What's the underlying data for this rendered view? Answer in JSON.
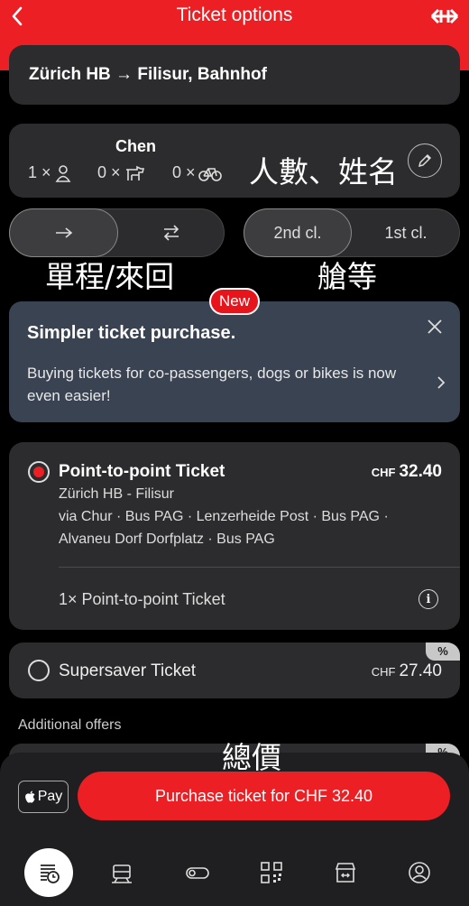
{
  "header": {
    "title": "Ticket options"
  },
  "route": {
    "text": "Zürich HB → Filisur, Bahnhof"
  },
  "travellers": {
    "name": "Chen",
    "adults": "1 ×",
    "dogs": "0 ×",
    "bikes": "0 ×"
  },
  "annotations": {
    "people": "人數、姓名",
    "trip_type": "單程/來回",
    "class": "艙等",
    "total": "總價"
  },
  "trip_toggle": {
    "one_way_icon": "arrow-right-icon",
    "return_icon": "arrows-swap-icon",
    "selected": "one-way"
  },
  "class_toggle": {
    "second": "2nd cl.",
    "first": "1st cl.",
    "selected": "2nd cl."
  },
  "promo": {
    "badge": "New",
    "title": "Simpler ticket purchase.",
    "body": "Buying tickets for co-passengers, dogs or bikes is now even easier!"
  },
  "ticket": {
    "title": "Point-to-point Ticket",
    "currency": "CHF",
    "amount": "32.40",
    "line1": "Zürich HB - Filisur",
    "line2": "via Chur · Bus PAG · Lenzerheide Post · Bus PAG ·",
    "line3": "Alvaneu Dorf Dorfplatz · Bus PAG",
    "sub": "1× Point-to-point Ticket",
    "info": "i"
  },
  "saver": {
    "title": "Supersaver Ticket",
    "currency": "CHF",
    "amount": "27.40",
    "badge": "%"
  },
  "additional": {
    "label": "Additional offers",
    "badge": "%"
  },
  "apple_pay": {
    "label": "Pay"
  },
  "purchase": {
    "label": "Purchase ticket for CHF 32.40"
  },
  "colors": {
    "accent": "#eb1f24",
    "card": "#2c2c2e",
    "background": "#000000"
  },
  "nav_icons": [
    "timetable-icon",
    "train-icon",
    "toggle-icon",
    "qr-code-icon",
    "shop-icon",
    "profile-icon"
  ]
}
